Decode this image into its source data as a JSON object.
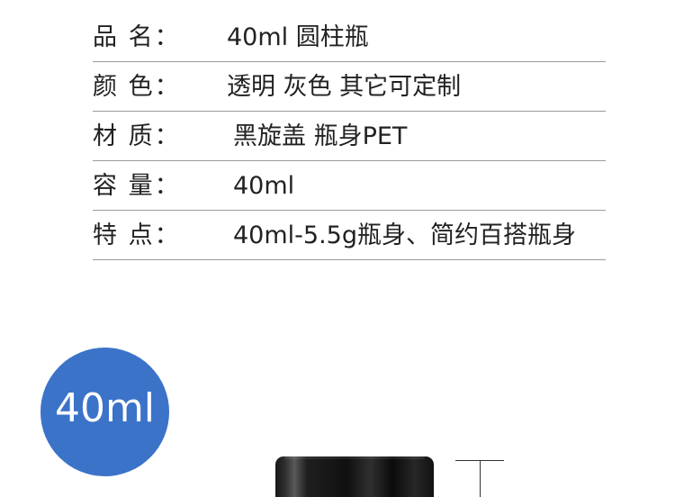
{
  "specs": {
    "rows": [
      {
        "label": "品 名：",
        "value": "40ml 圆柱瓶"
      },
      {
        "label": "颜 色：",
        "value": "透明 灰色  其它可定制"
      },
      {
        "label": "材 质：",
        "value": "黑旋盖 瓶身PET"
      },
      {
        "label": "容 量：",
        "value": "40ml"
      },
      {
        "label": "特 点：",
        "value": "40ml-5.5g瓶身、简约百搭瓶身"
      }
    ]
  },
  "capacity_badge": {
    "text": "40ml",
    "color": "#3b73c8"
  },
  "product": {
    "cap_color": "#111111",
    "divider_color": "#9a9a9a"
  }
}
